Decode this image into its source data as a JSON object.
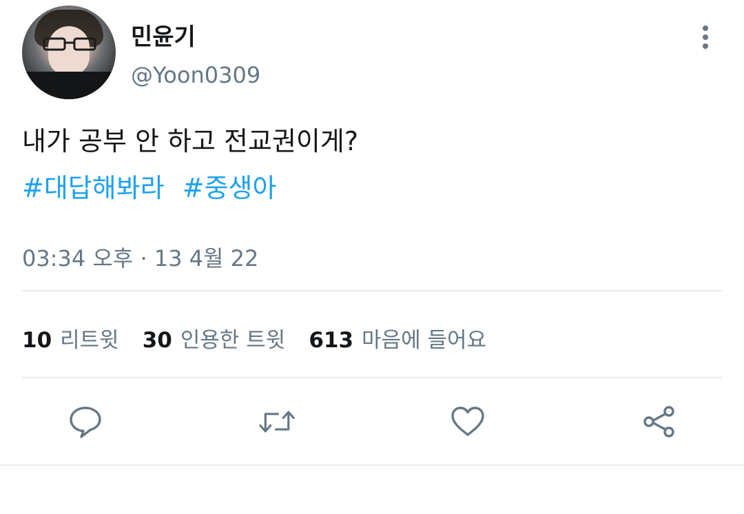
{
  "user": {
    "display_name": "민윤기",
    "handle": "@Yoon0309"
  },
  "tweet": {
    "text": "내가 공부 안 하고 전교권이게?",
    "hashtags": [
      "#대답해봐라",
      "#중생아"
    ],
    "timestamp": "03:34 오후 · 13 4월 22"
  },
  "stats": [
    {
      "count": "10",
      "label": "리트윗"
    },
    {
      "count": "30",
      "label": "인용한 트윗"
    },
    {
      "count": "613",
      "label": "마음에 들어요"
    }
  ],
  "icons": {
    "menu": "more-vertical-icon",
    "reply": "reply-icon",
    "retweet": "retweet-icon",
    "like": "heart-icon",
    "share": "share-icon"
  },
  "colors": {
    "hashtag": "#1da1f2",
    "secondary_text": "#657786",
    "icon": "#657786",
    "divider": "#e6ecf0"
  }
}
